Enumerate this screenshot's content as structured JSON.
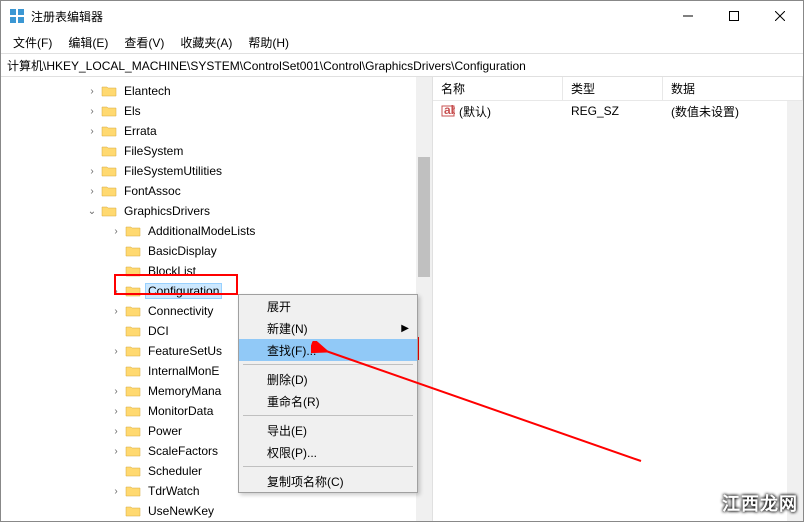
{
  "title": "注册表编辑器",
  "menubar": {
    "file": "文件(F)",
    "edit": "编辑(E)",
    "view": "查看(V)",
    "favorites": "收藏夹(A)",
    "help": "帮助(H)"
  },
  "address": "计算机\\HKEY_LOCAL_MACHINE\\SYSTEM\\ControlSet001\\Control\\GraphicsDrivers\\Configuration",
  "tree": {
    "items": [
      {
        "label": "Elantech",
        "expander": ">",
        "indent": 4
      },
      {
        "label": "Els",
        "expander": ">",
        "indent": 4
      },
      {
        "label": "Errata",
        "expander": ">",
        "indent": 4
      },
      {
        "label": "FileSystem",
        "expander": "",
        "indent": 4
      },
      {
        "label": "FileSystemUtilities",
        "expander": ">",
        "indent": 4
      },
      {
        "label": "FontAssoc",
        "expander": ">",
        "indent": 4
      },
      {
        "label": "GraphicsDrivers",
        "expander": "v",
        "indent": 4
      },
      {
        "label": "AdditionalModeLists",
        "expander": ">",
        "indent": 5
      },
      {
        "label": "BasicDisplay",
        "expander": "",
        "indent": 5
      },
      {
        "label": "BlockList",
        "expander": "",
        "indent": 5
      },
      {
        "label": "Configuration",
        "expander": ">",
        "indent": 5,
        "selected": true
      },
      {
        "label": "Connectivity",
        "expander": ">",
        "indent": 5
      },
      {
        "label": "DCI",
        "expander": "",
        "indent": 5
      },
      {
        "label": "FeatureSetUs",
        "expander": ">",
        "indent": 5
      },
      {
        "label": "InternalMonE",
        "expander": "",
        "indent": 5
      },
      {
        "label": "MemoryMana",
        "expander": ">",
        "indent": 5
      },
      {
        "label": "MonitorData",
        "expander": ">",
        "indent": 5
      },
      {
        "label": "Power",
        "expander": ">",
        "indent": 5
      },
      {
        "label": "ScaleFactors",
        "expander": ">",
        "indent": 5
      },
      {
        "label": "Scheduler",
        "expander": "",
        "indent": 5
      },
      {
        "label": "TdrWatch",
        "expander": ">",
        "indent": 5
      },
      {
        "label": "UseNewKey",
        "expander": "",
        "indent": 5
      }
    ]
  },
  "list": {
    "columns": {
      "name": "名称",
      "type": "类型",
      "data": "数据"
    },
    "rows": [
      {
        "name": "(默认)",
        "type": "REG_SZ",
        "data": "(数值未设置)"
      }
    ]
  },
  "context_menu": {
    "expand": "展开",
    "new": "新建(N)",
    "find": "查找(F)...",
    "delete": "删除(D)",
    "rename": "重命名(R)",
    "export": "导出(E)",
    "permissions": "权限(P)...",
    "copy_key_name": "复制项名称(C)"
  },
  "watermark": "江西龙网"
}
